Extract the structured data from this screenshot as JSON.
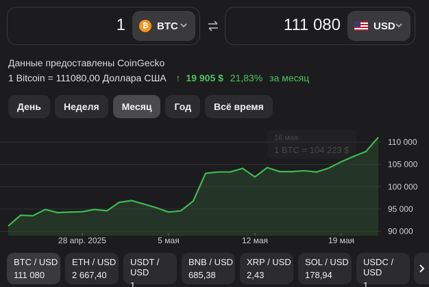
{
  "converter": {
    "from": {
      "amount": "1",
      "currency": "BTC",
      "icon": "bitcoin-icon",
      "icon_glyph": "₿",
      "icon_color": "#f7931a"
    },
    "to": {
      "amount": "111 080",
      "currency": "USD",
      "icon": "us-flag-icon"
    }
  },
  "source_text": "Данные предоставлены CoinGecko",
  "rate": {
    "text": "1 Bitcoin = 111080,00 Доллара США",
    "arrow": "↑",
    "change": "19 905 $",
    "percent": "21,83%",
    "period": "за месяц",
    "color": "#4cc45a"
  },
  "periods": [
    {
      "label": "День",
      "active": false
    },
    {
      "label": "Неделя",
      "active": false
    },
    {
      "label": "Месяц",
      "active": true
    },
    {
      "label": "Год",
      "active": false
    },
    {
      "label": "Всё время",
      "active": false
    }
  ],
  "tooltip": {
    "date": "16 мая",
    "value": "1 BTC = 104 223 $"
  },
  "chart_data": {
    "type": "area",
    "x": [
      "2025-04-22",
      "2025-04-23",
      "2025-04-24",
      "2025-04-25",
      "2025-04-26",
      "2025-04-27",
      "2025-04-28",
      "2025-04-29",
      "2025-04-30",
      "2025-05-01",
      "2025-05-02",
      "2025-05-03",
      "2025-05-04",
      "2025-05-05",
      "2025-05-06",
      "2025-05-07",
      "2025-05-08",
      "2025-05-09",
      "2025-05-10",
      "2025-05-11",
      "2025-05-12",
      "2025-05-13",
      "2025-05-14",
      "2025-05-15",
      "2025-05-16",
      "2025-05-17",
      "2025-05-18",
      "2025-05-19",
      "2025-05-20",
      "2025-05-21",
      "2025-05-22"
    ],
    "series": [
      {
        "values": [
          91200,
          93600,
          93500,
          94900,
          94200,
          94300,
          94400,
          94900,
          94600,
          96500,
          96900,
          96100,
          95300,
          94300,
          94600,
          96800,
          103000,
          103300,
          103300,
          104100,
          102200,
          104300,
          103400,
          103400,
          103600,
          103300,
          104200,
          105600,
          106800,
          107900,
          111080
        ],
        "color": "#3fb94f"
      }
    ],
    "xticks": [
      {
        "label": "28 апр. 2025",
        "x": "2025-04-28"
      },
      {
        "label": "5 мая",
        "x": "2025-05-05"
      },
      {
        "label": "12 мая",
        "x": "2025-05-12"
      },
      {
        "label": "19 мая",
        "x": "2025-05-19"
      }
    ],
    "yticks": [
      "110 000",
      "105 000",
      "100 000",
      "95 000",
      "90 000"
    ],
    "ylim": [
      89000,
      112000
    ],
    "grid": true
  },
  "pairs": [
    {
      "name": "BTC / USD",
      "value": "111 080",
      "active": true
    },
    {
      "name": "ETH / USD",
      "value": "2 667,40",
      "active": false
    },
    {
      "name": "USDT / USD",
      "value": "1",
      "active": false
    },
    {
      "name": "BNB / USD",
      "value": "685,38",
      "active": false
    },
    {
      "name": "XRP / USD",
      "value": "2,43",
      "active": false
    },
    {
      "name": "SOL / USD",
      "value": "178,94",
      "active": false
    },
    {
      "name": "USDC / USD",
      "value": "1",
      "active": false
    }
  ]
}
